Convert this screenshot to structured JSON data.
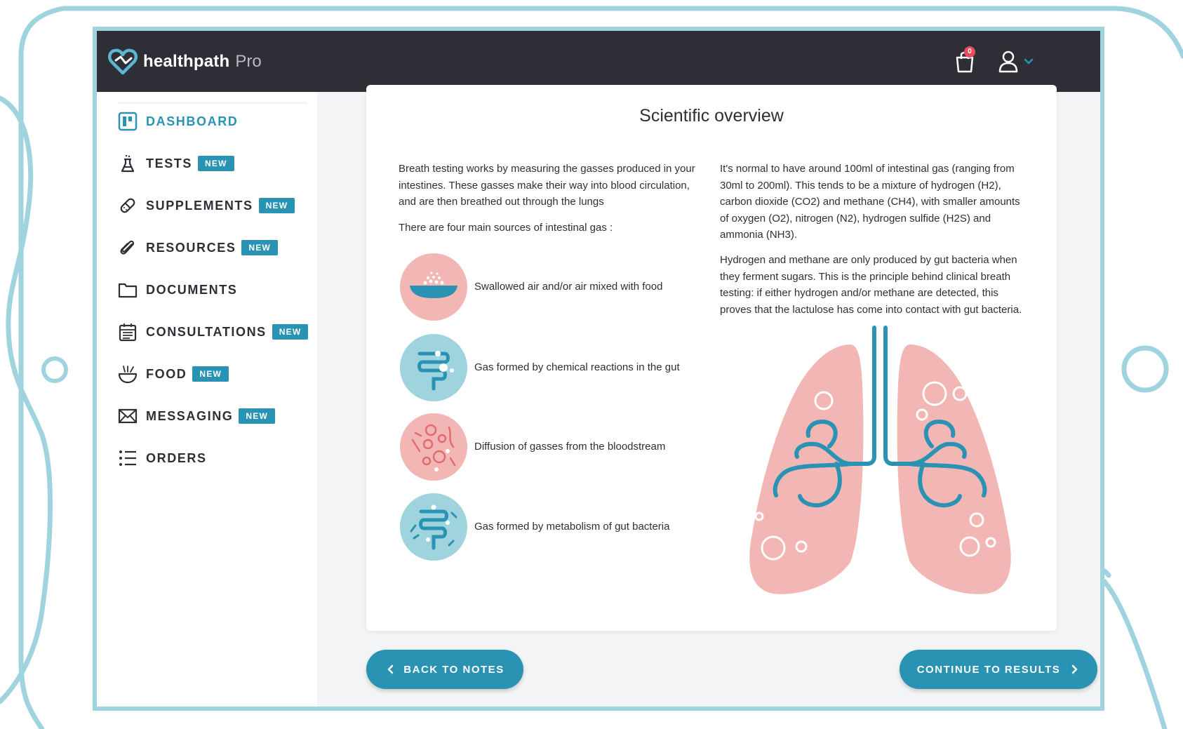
{
  "app": {
    "brand_name": "healthpath",
    "brand_suffix": "Pro",
    "cart_count": "0"
  },
  "sidebar": {
    "items": [
      {
        "label": "DASHBOARD",
        "icon": "dashboard-icon",
        "active": true,
        "badge": ""
      },
      {
        "label": "TESTS",
        "icon": "flask-icon",
        "badge": "NEW"
      },
      {
        "label": "SUPPLEMENTS",
        "icon": "pill-icon",
        "badge": "NEW"
      },
      {
        "label": "RESOURCES",
        "icon": "paperclip-icon",
        "badge": "NEW"
      },
      {
        "label": "DOCUMENTS",
        "icon": "folder-icon",
        "badge": ""
      },
      {
        "label": "CONSULTATIONS",
        "icon": "calendar-icon",
        "badge": "NEW"
      },
      {
        "label": "FOOD",
        "icon": "bowl-icon",
        "badge": "NEW"
      },
      {
        "label": "MESSAGING",
        "icon": "envelope-icon",
        "badge": "NEW"
      },
      {
        "label": "ORDERS",
        "icon": "list-icon",
        "badge": ""
      }
    ]
  },
  "overview": {
    "title": "Scientific overview",
    "intro": "Breath testing works by measuring the gasses produced in your intestines. These gasses make their way into blood circulation, and are then breathed out through the lungs",
    "sources_title": "There are four main sources of intestinal gas :",
    "sources": [
      {
        "text": "Swallowed air and/or air mixed with food",
        "icon": "food-bowl-icon"
      },
      {
        "text": "Gas formed by chemical reactions in the gut",
        "icon": "gut-reaction-icon"
      },
      {
        "text": "Diffusion of gasses from the bloodstream",
        "icon": "bloodstream-icon"
      },
      {
        "text": "Gas formed by metabolism of gut bacteria",
        "icon": "gut-bacteria-icon"
      }
    ],
    "normal_gas": "It's normal to have around 100ml of intestinal gas (ranging from 30ml to 200ml). This tends to be a mixture of hydrogen (H2), carbon dioxide (CO2) and methane (CH4), with smaller amounts of oxygen (O2), nitrogen (N2), hydrogen sulfide (H2S) and ammonia (NH3).",
    "hydrogen_methane": "Hydrogen and methane are only produced by gut bacteria when they ferment sugars. This is the principle behind clinical breath testing: if either hydrogen and/or methane are detected, this proves that the lactulose has come into contact with gut bacteria."
  },
  "buttons": {
    "back": "BACK TO NOTES",
    "continue": "CONTINUE TO RESULTS"
  },
  "colors": {
    "accent": "#2a93b3",
    "topbar": "#2e2f36",
    "pink": "#f2b6b4",
    "teal_light": "#9fd3de",
    "badge_red": "#e84b5a"
  }
}
